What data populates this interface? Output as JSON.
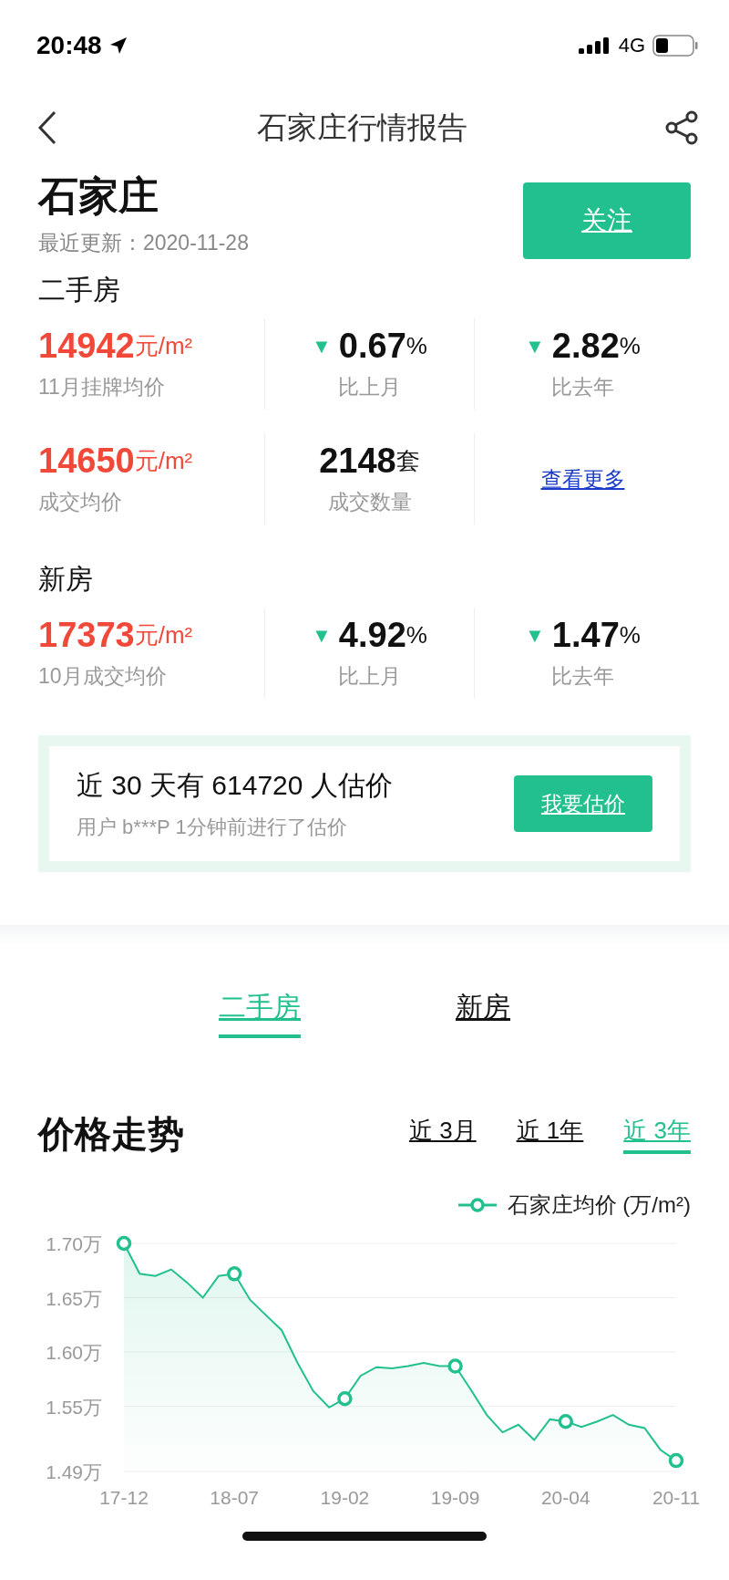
{
  "status_bar": {
    "time": "20:48",
    "network": "4G"
  },
  "nav": {
    "title": "石家庄行情报告"
  },
  "header": {
    "city": "石家庄",
    "updated": "最近更新：2020-11-28",
    "follow_button": "关注"
  },
  "sections": [
    {
      "title": "二手房",
      "rows": [
        [
          {
            "kind": "price",
            "value": "14942",
            "unit": "元/m²",
            "label": "11月挂牌均价"
          },
          {
            "kind": "change",
            "arrow": "▼",
            "value": "0.67",
            "unit": "%",
            "label": "比上月"
          },
          {
            "kind": "change",
            "arrow": "▼",
            "value": "2.82",
            "unit": "%",
            "label": "比去年"
          }
        ],
        [
          {
            "kind": "price",
            "value": "14650",
            "unit": "元/m²",
            "label": "成交均价"
          },
          {
            "kind": "count",
            "value": "2148",
            "unit": "套",
            "label": "成交数量"
          },
          {
            "kind": "link",
            "value": "查看更多"
          }
        ]
      ]
    },
    {
      "title": "新房",
      "rows": [
        [
          {
            "kind": "price",
            "value": "17373",
            "unit": "元/m²",
            "label": "10月成交均价"
          },
          {
            "kind": "change",
            "arrow": "▼",
            "value": "4.92",
            "unit": "%",
            "label": "比上月"
          },
          {
            "kind": "change",
            "arrow": "▼",
            "value": "1.47",
            "unit": "%",
            "label": "比去年"
          }
        ]
      ]
    }
  ],
  "estimate_banner": {
    "headline": "近 30 天有 614720 人估价",
    "subtext": "用户 b***P 1分钟前进行了估价",
    "button": "我要估价"
  },
  "tabs": [
    {
      "label": "二手房",
      "selected": true
    },
    {
      "label": "新房",
      "selected": false
    }
  ],
  "trend": {
    "title": "价格走势",
    "ranges": [
      {
        "label": "近 3月",
        "selected": false
      },
      {
        "label": "近 1年",
        "selected": false
      },
      {
        "label": "近 3年",
        "selected": true
      }
    ],
    "chart_data": {
      "type": "area",
      "categories": [
        "17-12",
        null,
        null,
        null,
        null,
        null,
        null,
        "18-07",
        null,
        null,
        null,
        null,
        null,
        null,
        "19-02",
        null,
        null,
        null,
        null,
        null,
        null,
        "19-09",
        null,
        null,
        null,
        null,
        null,
        null,
        "20-04",
        null,
        null,
        null,
        null,
        null,
        null,
        "20-11"
      ],
      "grid": true,
      "series": [
        {
          "name": "石家庄均价 (万/m²)",
          "color": "#22c08e",
          "values": [
            1.7,
            1.672,
            1.67,
            1.676,
            1.664,
            1.65,
            1.67,
            1.672,
            1.648,
            1.634,
            1.62,
            1.59,
            1.564,
            1.549,
            1.557,
            1.578,
            1.586,
            1.585,
            1.587,
            1.59,
            1.587,
            1.587,
            1.565,
            1.542,
            1.526,
            1.533,
            1.519,
            1.538,
            1.536,
            1.531,
            1.536,
            1.542,
            1.533,
            1.53,
            1.51,
            1.5
          ]
        }
      ],
      "ylim": [
        1.49,
        1.7
      ],
      "yticks": [
        {
          "value": 1.7,
          "label": "1.70万"
        },
        {
          "value": 1.65,
          "label": "1.65万"
        },
        {
          "value": 1.6,
          "label": "1.60万"
        },
        {
          "value": 1.55,
          "label": "1.55万"
        },
        {
          "value": 1.49,
          "label": "1.49万"
        }
      ]
    }
  }
}
